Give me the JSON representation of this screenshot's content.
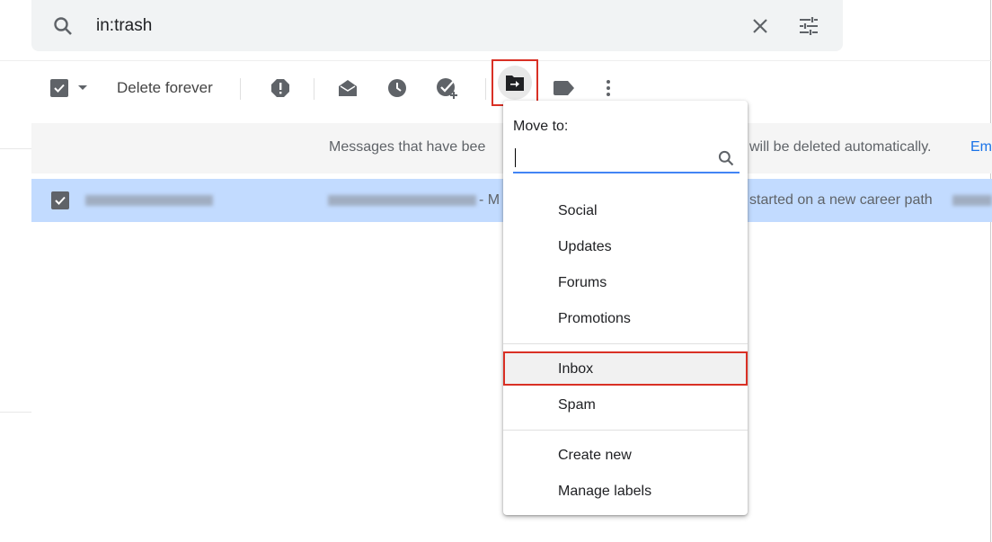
{
  "search": {
    "query": "in:trash",
    "icons": [
      "search-icon",
      "close-icon",
      "tune-icon"
    ]
  },
  "toolbar": {
    "delete_forever_label": "Delete forever",
    "icons": [
      "select-checkbox",
      "dropdown-arrow-icon",
      "report-spam-icon",
      "mark-read-icon",
      "snooze-icon",
      "add-to-tasks-icon",
      "move-to-icon",
      "label-icon",
      "more-vert-icon"
    ]
  },
  "info_bar": {
    "text_start": "Messages that have bee",
    "text_end": "will be deleted automatically.",
    "link": "Em"
  },
  "email_row": {
    "selected": true,
    "snippet_start": "- M",
    "snippet_end": "started on a new career path"
  },
  "move_menu": {
    "title": "Move to:",
    "search_value": "",
    "items": [
      "Social",
      "Updates",
      "Forums",
      "Promotions"
    ],
    "system_items": [
      "Inbox",
      "Spam"
    ],
    "actions": [
      "Create new",
      "Manage labels"
    ],
    "highlighted": "Inbox"
  },
  "colors": {
    "highlight_border": "#d93025",
    "selected_row": "#c2dbff",
    "link": "#1a73e8",
    "input_underline": "#4285f4"
  }
}
